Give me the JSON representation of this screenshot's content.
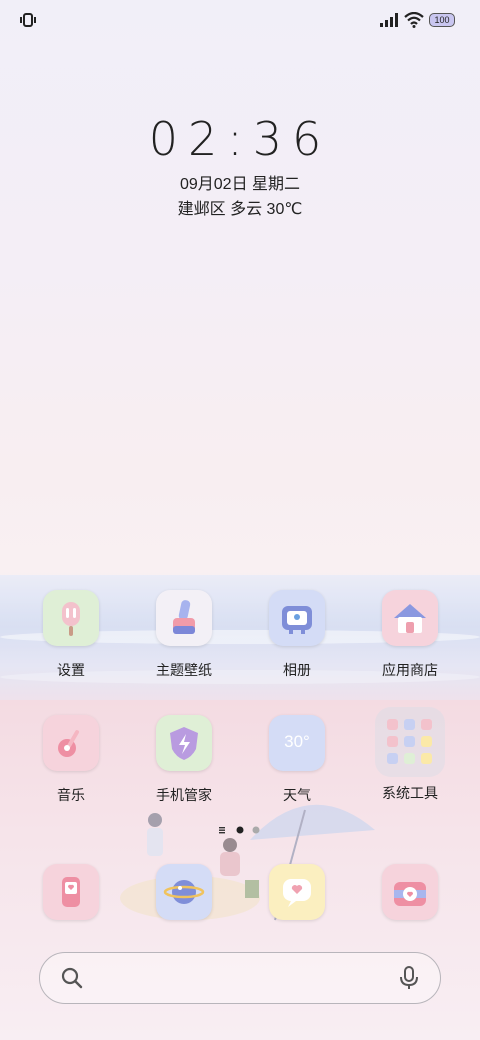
{
  "status_bar": {
    "battery": "100"
  },
  "lock": {
    "time": "02:36",
    "date": "09月02日 星期二",
    "weather": "建邺区 多云 30℃"
  },
  "apps": [
    {
      "label": "设置",
      "icon": "settings-popsicle-icon"
    },
    {
      "label": "主题壁纸",
      "icon": "theme-brush-icon"
    },
    {
      "label": "相册",
      "icon": "gallery-tv-icon"
    },
    {
      "label": "应用商店",
      "icon": "store-house-icon"
    },
    {
      "label": "音乐",
      "icon": "music-guitar-icon"
    },
    {
      "label": "手机管家",
      "icon": "phone-manager-shield-icon"
    },
    {
      "label": "天气",
      "icon": "weather-icon",
      "badge": "30°"
    },
    {
      "label": "系统工具",
      "icon": "system-tools-folder-icon"
    }
  ],
  "dock": [
    {
      "icon": "phone-icon"
    },
    {
      "icon": "browser-planet-icon"
    },
    {
      "icon": "messages-icon"
    },
    {
      "icon": "camera-icon"
    }
  ],
  "colors": {
    "pink": "#f6d3dc",
    "green": "#dfefd6",
    "blue": "#d4dcf6",
    "yellow": "#fbefc0"
  }
}
